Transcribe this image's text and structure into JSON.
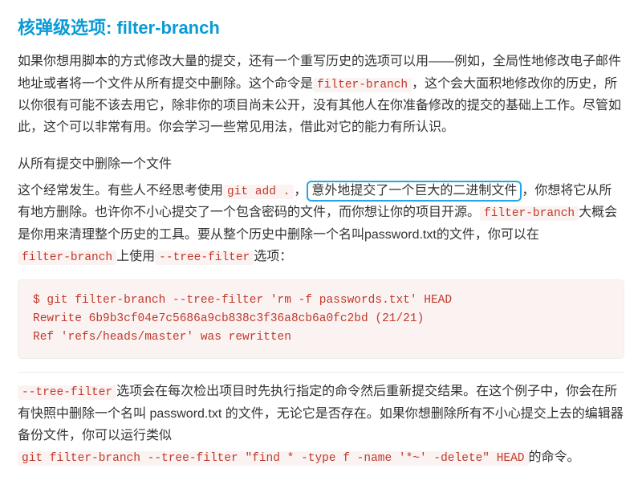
{
  "heading": {
    "prefix": "核弹级选项:",
    "code": " filter-branch"
  },
  "intro": {
    "p1_a": "如果你想用脚本的方式修改大量的提交，还有一个重写历史的选项可以用——例如，全局性地修改电子邮件地址或者将一个文件从所有提交中删除。这个命令是",
    "code1": "filter-branch",
    "p1_b": "，这个会大面积地修改你的历史，所以你很有可能不该去用它，除非你的项目尚未公开，没有其他人在你准备修改的提交的基础上工作。尽管如此，这个可以非常有用。你会学习一些常见用法，借此对它的能力有所认识。"
  },
  "section": {
    "title": "从所有提交中删除一个文件",
    "p1_a": "这个经常发生。有些人不经思考使用",
    "code1": "git add .",
    "p1_punc1": "，",
    "highlight": "意外地提交了一个巨大的二进制文件",
    "p1_b": "你想将它从所有地方删除。也许你不小心提交了一个包含密码的文件，而你想让你的项目开源。",
    "code2": "filter-branch",
    "p1_c": "大概会是你用来清理整个历史的工具。要从整个历史中删除一个名叫password.txt的文件，你可以在",
    "code3": "filter-branch",
    "p1_d": "上使用",
    "code4": "--tree-filter",
    "p1_e": "选项："
  },
  "codeblock": "$ git filter-branch --tree-filter 'rm -f passwords.txt' HEAD\nRewrite 6b9b3cf04e7c5686a9cb838c3f36a8cb6a0fc2bd (21/21)\nRef 'refs/heads/master' was rewritten",
  "after": {
    "code1": "--tree-filter",
    "p1_a": "选项会在每次检出项目时先执行指定的命令然后重新提交结果。在这个例子中，你会在所有快照中删除一个名叫 password.txt 的文件，无论它是否存在。如果你想删除所有不小心提交上去的编辑器备份文件，你可以运行类似",
    "code2": "git filter-branch --tree-filter \"find * -type f -name '*~' -delete\" HEAD",
    "p1_b": "的命令。"
  }
}
